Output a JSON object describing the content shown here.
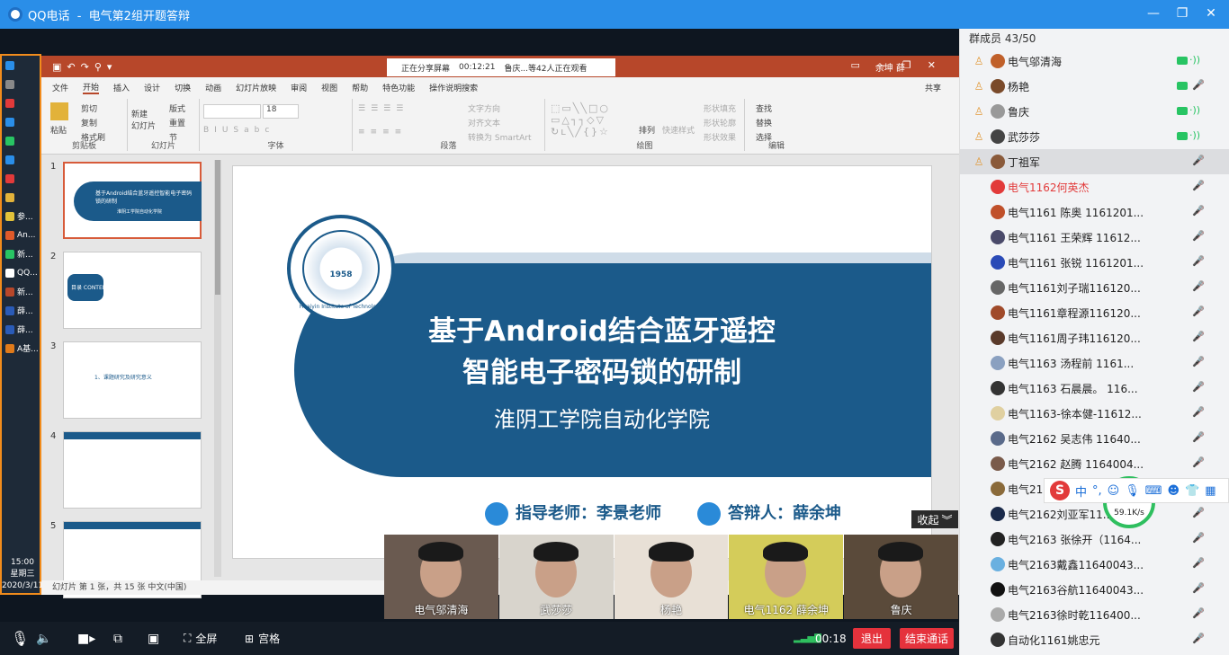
{
  "window": {
    "title": "QQ电话  -  电气第2组开题答辩"
  },
  "taskbar": {
    "items": [
      {
        "label": "",
        "color": "#2a8ee8"
      },
      {
        "label": "",
        "color": "#888"
      },
      {
        "label": "",
        "color": "#e23a3a"
      },
      {
        "label": "",
        "color": "#2a8ee8"
      },
      {
        "label": "",
        "color": "#28c463"
      },
      {
        "label": "",
        "color": "#2a8ee8"
      },
      {
        "label": "",
        "color": "#e23a3a"
      },
      {
        "label": "",
        "color": "#e2b23a"
      },
      {
        "label": "参...",
        "color": "#e2c23a"
      },
      {
        "label": "An...",
        "color": "#e05a2a"
      },
      {
        "label": "新...",
        "color": "#28c463"
      },
      {
        "label": "QQ...",
        "color": "#fff"
      },
      {
        "label": "新...",
        "color": "#b7472a"
      },
      {
        "label": "薛...",
        "color": "#2a5bb7"
      },
      {
        "label": "薛...",
        "color": "#2a5bb7"
      },
      {
        "label": "A基...",
        "color": "#e07a1a"
      }
    ],
    "clock_time": "15:00",
    "clock_day": "星期三",
    "clock_date": "2020/3/11"
  },
  "ppt": {
    "share_status": "正在分享屏幕",
    "share_time": "00:12:21",
    "viewers": "鲁庆...等42人正在观看",
    "user": "余坤 薛",
    "tabs": [
      "文件",
      "开始",
      "插入",
      "设计",
      "切换",
      "动画",
      "幻灯片放映",
      "审阅",
      "视图",
      "帮助",
      "特色功能",
      "操作说明搜索"
    ],
    "share_label": "共享",
    "groups": {
      "clipboard": "剪贴板",
      "slides": "幻灯片",
      "font": "字体",
      "paragraph": "段落",
      "drawing": "绘图",
      "editing": "编辑"
    },
    "buttons": {
      "paste": "粘贴",
      "cut": "剪切",
      "copy": "复制",
      "format_painter": "格式刷",
      "new_slide": "新建\n幻灯片",
      "layout": "版式",
      "reset": "重置",
      "section": "节",
      "font_name": "",
      "font_size": "18",
      "text_direction": "文字方向",
      "align_text": "对齐文本",
      "smartart": "转换为 SmartArt",
      "arrange": "排列",
      "quick_styles": "快速样式",
      "fill": "形状填充",
      "outline": "形状轮廓",
      "effects": "形状效果",
      "find": "查找",
      "replace": "替换",
      "select": "选择"
    },
    "statusbar": "幻灯片 第 1 张，共 15 张    中文(中国)",
    "thumbs": [
      {
        "num": "1",
        "title": "基于Android结合蓝牙遥控智能电子密码锁的研制",
        "sub": "淮阴工学院自动化学院"
      },
      {
        "num": "2",
        "title": "目录 CONTENTS"
      },
      {
        "num": "3",
        "title": "1、课题研究及研究意义"
      },
      {
        "num": "4",
        "title": ""
      },
      {
        "num": "5",
        "title": ""
      }
    ]
  },
  "slide": {
    "title_line1": "基于Android结合蓝牙遥控",
    "title_line2": "智能电子密码锁的研制",
    "school": "淮阴工学院自动化学院",
    "seal_text": "Huaiyin Institute of Technology",
    "seal_year": "1958",
    "advisor": "指导老师：李景老师",
    "defender": "答辩人：薛余坤"
  },
  "collapse_label": "收起",
  "videos": [
    {
      "name": "电气邬清海",
      "bg": "#6a5a50"
    },
    {
      "name": "武莎莎",
      "bg": "#d8d4cc"
    },
    {
      "name": "杨艳",
      "bg": "#e8e0d6"
    },
    {
      "name": "电气1162 薛余坤",
      "bg": "#d4cc5a"
    },
    {
      "name": "鲁庆",
      "bg": "#5a4a3a"
    }
  ],
  "bottombar": {
    "fullscreen": "全屏",
    "grid": "宫格",
    "timer": "00:18",
    "exit": "退出",
    "end_call": "结束通话"
  },
  "panel": {
    "header": "群成员 43/50",
    "members": [
      {
        "name": "电气邬清海",
        "av": "#c0602a",
        "cam": true,
        "snd": true
      },
      {
        "name": "杨艳",
        "av": "#7a4a2a",
        "cam": true,
        "snd": false
      },
      {
        "name": "鲁庆",
        "av": "#999",
        "cam": true,
        "snd": true
      },
      {
        "name": "武莎莎",
        "av": "#444",
        "cam": true,
        "snd": true
      },
      {
        "name": "丁祖军",
        "av": "#8a5a3a",
        "cam": false,
        "snd": false,
        "sel": true
      },
      {
        "name": "电气1162何英杰",
        "av": "#e23a3a",
        "red": true
      },
      {
        "name": "电气1161 陈奥 1161201...",
        "av": "#c0502a"
      },
      {
        "name": "电气1161 王荣辉 11612...",
        "av": "#4a4a6a"
      },
      {
        "name": "电气1161 张锐 1161201...",
        "av": "#2a4ab7"
      },
      {
        "name": "电气1161刘子瑞116120...",
        "av": "#666"
      },
      {
        "name": "电气1161章程源116120...",
        "av": "#a04a2a"
      },
      {
        "name": "电气1161周子玮116120...",
        "av": "#5a3a2a"
      },
      {
        "name": "电气1163  汤程前  1161...",
        "av": "#8aa0c0"
      },
      {
        "name": "电气1163 石晨晨。   116...",
        "av": "#333"
      },
      {
        "name": "电气1163-徐本健-11612...",
        "av": "#e0d0a0"
      },
      {
        "name": "电气2162 吴志伟 11640...",
        "av": "#5a6a8a"
      },
      {
        "name": "电气2162 赵腾 1164004...",
        "av": "#7a5a4a"
      },
      {
        "name": "电气216...",
        "av": "#8a6a3a"
      },
      {
        "name": "电气2162刘亚军11...",
        "av": "#1a2a4a"
      },
      {
        "name": "电气2163 张徐开（1164...",
        "av": "#222"
      },
      {
        "name": "电气2163戴鑫11640043...",
        "av": "#6ab0e0"
      },
      {
        "name": "电气2163谷航11640043...",
        "av": "#111"
      },
      {
        "name": "电气2163徐时乾116400...",
        "av": "#aaa"
      },
      {
        "name": "自动化1161姚忠元",
        "av": "#333"
      }
    ]
  },
  "ime": {
    "lang": "中",
    "punct": "°,"
  },
  "net": {
    "percent": "57%",
    "up": "51",
    "down": "59.1K/s"
  }
}
